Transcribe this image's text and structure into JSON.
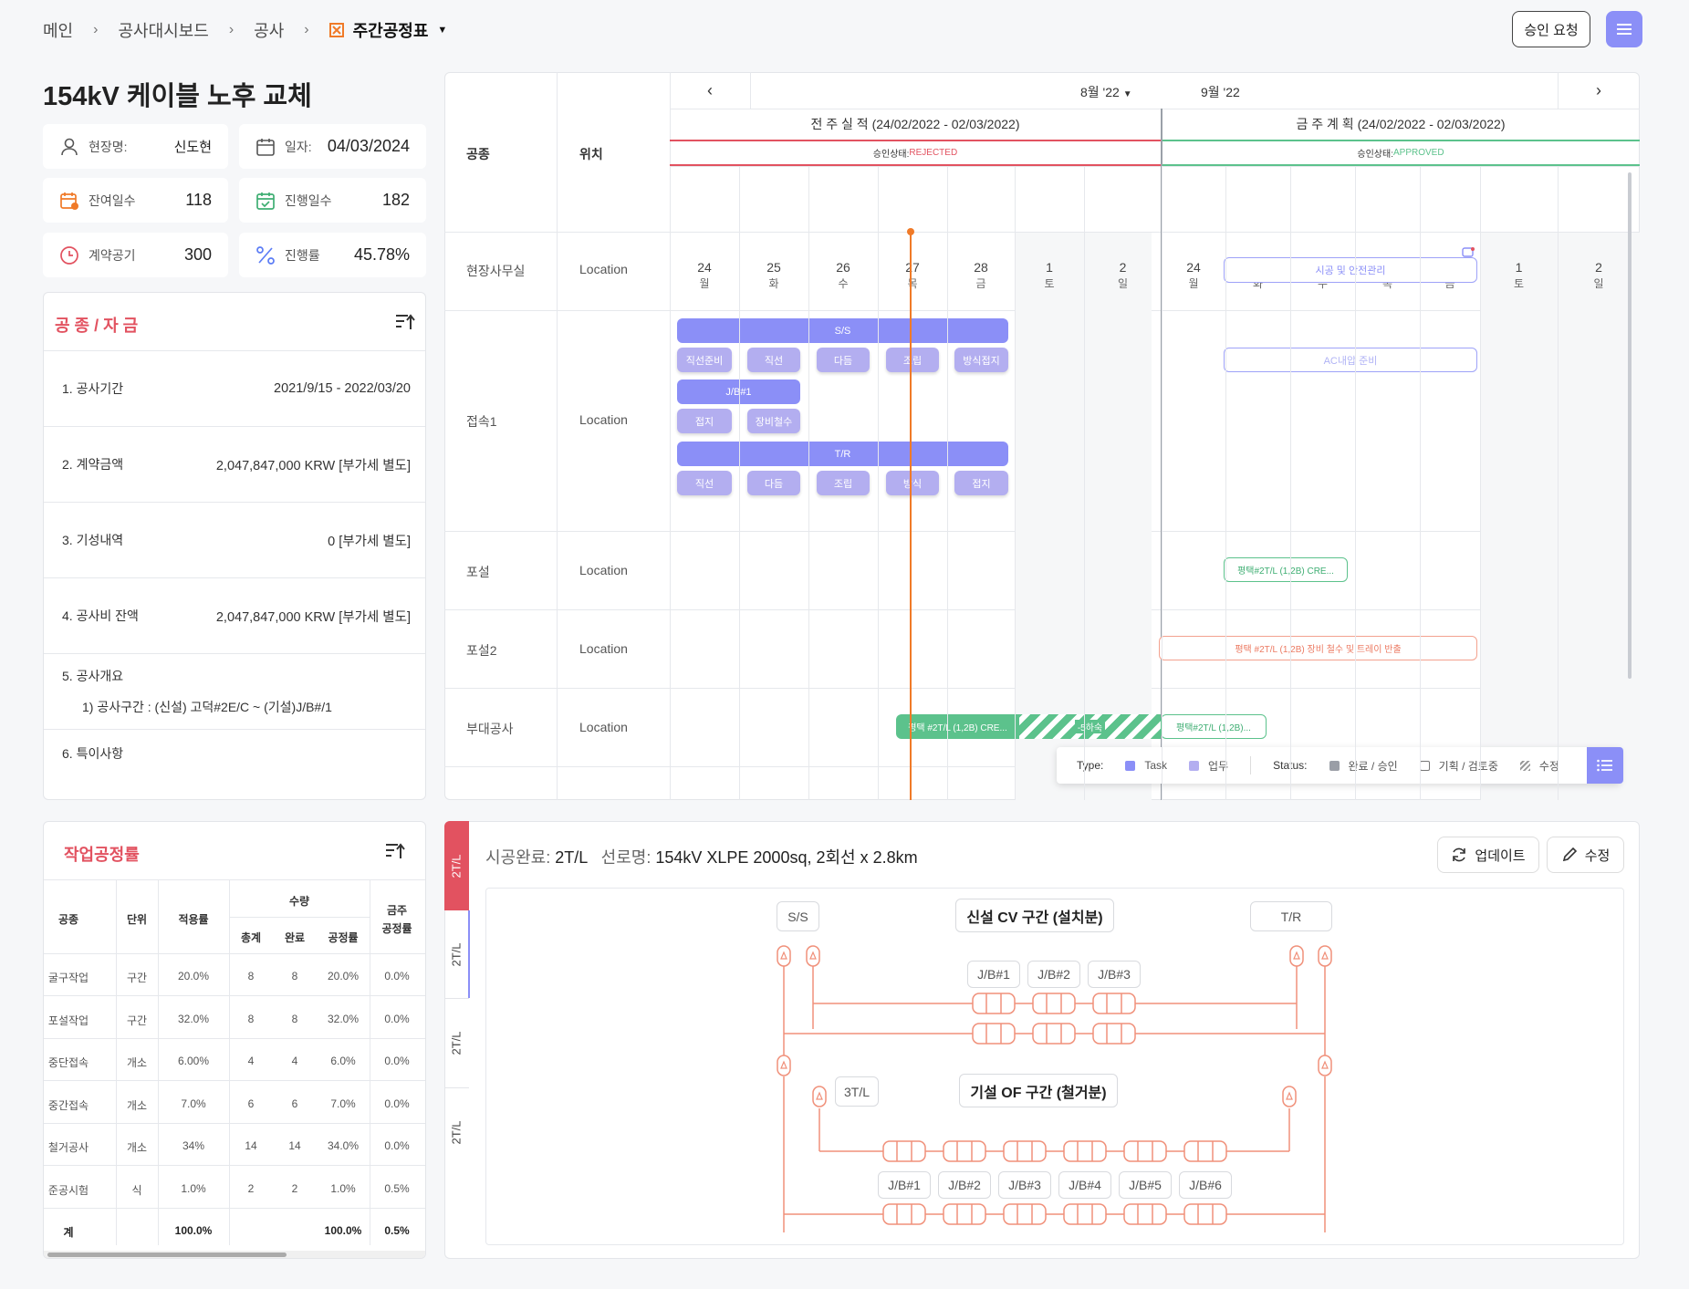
{
  "breadcrumb": {
    "items": [
      "메인",
      "공사대시보드",
      "공사"
    ],
    "current": "주간공정표"
  },
  "header": {
    "approve_label": "승인 요청"
  },
  "project": {
    "title": "154kV 케이블 노후 교체"
  },
  "info": {
    "manager_label": "현장명:",
    "manager_value": "신도현",
    "date_label": "일자:",
    "date_value": "04/03/2024",
    "remaining_label": "잔여일수",
    "remaining_value": "118",
    "progress_days_label": "진행일수",
    "progress_days_value": "182",
    "contract_label": "계약공기",
    "contract_value": "300",
    "rate_label": "진행률",
    "rate_value": "45.78%"
  },
  "funds": {
    "title": "공 종 / 자 금",
    "rows": [
      {
        "label": "1. 공사기간",
        "value": "2021/9/15 - 2022/03/20"
      },
      {
        "label": "2. 계약금액",
        "value": "2,047,847,000 KRW [부가세 별도]"
      },
      {
        "label": "3. 기성내역",
        "value": "0 [부가세 별도]"
      },
      {
        "label": "4. 공사비 잔액",
        "value": "2,047,847,000 KRW [부가세 별도]"
      },
      {
        "label": "5. 공사개요",
        "value": ""
      },
      {
        "label": "6. 특이사항",
        "value": ""
      }
    ],
    "overview": "1) 공사구간 : (신설) 고덕#2E/C ~ (기설)J/B#/1"
  },
  "gantt": {
    "col_work": "공종",
    "col_location": "위치",
    "month1": "8월 '22",
    "month2": "9월 '22",
    "prev_title": "전 주 실 적 (24/02/2022 - 02/03/2022)",
    "next_title": "금 주 계 획 (24/02/2022 - 02/03/2022)",
    "status_label": "승인상태:",
    "prev_status": "REJECTED",
    "next_status": "APPROVED",
    "days": [
      {
        "d": "24",
        "w": "월"
      },
      {
        "d": "25",
        "w": "화"
      },
      {
        "d": "26",
        "w": "수"
      },
      {
        "d": "27",
        "w": "목"
      },
      {
        "d": "28",
        "w": "금"
      },
      {
        "d": "1",
        "w": "토"
      },
      {
        "d": "2",
        "w": "일"
      },
      {
        "d": "24",
        "w": "월"
      },
      {
        "d": "25",
        "w": "화"
      },
      {
        "d": "26",
        "w": "수"
      },
      {
        "d": "27",
        "w": "목"
      },
      {
        "d": "28",
        "w": "금"
      },
      {
        "d": "1",
        "w": "토"
      },
      {
        "d": "2",
        "w": "일"
      }
    ],
    "rows": [
      {
        "name": "현장사무실",
        "loc": "Location"
      },
      {
        "name": "접속1",
        "loc": "Location"
      },
      {
        "name": "포설",
        "loc": "Location"
      },
      {
        "name": "포설2",
        "loc": "Location"
      },
      {
        "name": "부대공사",
        "loc": "Location"
      }
    ],
    "bars": {
      "ss": "S/S",
      "jb": "J/B#1",
      "tr": "T/R",
      "ss_tasks": [
        "직선준비",
        "직선",
        "다듬",
        "조립",
        "방식접지"
      ],
      "jb_tasks": [
        "접지",
        "장비철수"
      ],
      "tr_tasks": [
        "직선",
        "다듬",
        "조립",
        "방식",
        "접지"
      ],
      "safety": "시공 및 안전관리",
      "ac": "AC내압 준비",
      "pole1": "평택#2T/L (1,2B) CRE...",
      "pole2": "평택 #2T/L (1,2B) 장비 철수 및 트레이 반출",
      "sub1": "평택 #2T/L (1,2B) CRE...",
      "sub_delay": "-5하숙",
      "sub2": "평택#2T/L (1,2B)..."
    },
    "legend": {
      "type_label": "Type:",
      "task": "Task",
      "work": "업무",
      "status_label": "Status:",
      "done": "완료 / 승인",
      "plan": "기획 / 검토중",
      "edit": "수정"
    }
  },
  "work": {
    "title": "작업공정률",
    "headers": {
      "type": "공종",
      "unit": "단위",
      "rate": "적용률",
      "qty": "수량",
      "total": "총계",
      "done": "완료",
      "prog": "공정률",
      "week": "금주",
      "week2": "공정률"
    },
    "rows": [
      {
        "type": "굴구작업",
        "unit": "구간",
        "rate": "20.0%",
        "total": "8",
        "done": "8",
        "prog": "20.0%",
        "week": "0.0%"
      },
      {
        "type": "포설작업",
        "unit": "구간",
        "rate": "32.0%",
        "total": "8",
        "done": "8",
        "prog": "32.0%",
        "week": "0.0%"
      },
      {
        "type": "중단접속",
        "unit": "개소",
        "rate": "6.00%",
        "total": "4",
        "done": "4",
        "prog": "6.0%",
        "week": "0.0%"
      },
      {
        "type": "중간접속",
        "unit": "개소",
        "rate": "7.0%",
        "total": "6",
        "done": "6",
        "prog": "7.0%",
        "week": "0.0%"
      },
      {
        "type": "철거공사",
        "unit": "개소",
        "rate": "34%",
        "total": "14",
        "done": "14",
        "prog": "34.0%",
        "week": "0.0%"
      },
      {
        "type": "준공시험",
        "unit": "식",
        "rate": "1.0%",
        "total": "2",
        "done": "2",
        "prog": "1.0%",
        "week": "0.5%"
      }
    ],
    "sum": {
      "type": "계",
      "rate": "100.0%",
      "prog": "100.0%",
      "week": "0.5%"
    }
  },
  "circuit": {
    "done_label": "시공완료:",
    "done_value": "2T/L",
    "line_label": "선로명:",
    "line_value": "154kV XLPE 2000sq, 2회선 x 2.8km",
    "update": "업데이트",
    "edit": "수정",
    "tabs": [
      "2T/L",
      "2T/L",
      "2T/L",
      "2T/L"
    ],
    "ss": "S/S",
    "tr": "T/R",
    "new_section": "신설 CV 구간 (설치분)",
    "old_section": "기설 OF 구간 (철거분)",
    "t3": "3T/L",
    "jb_top": [
      "J/B#1",
      "J/B#2",
      "J/B#3"
    ],
    "jb_bottom": [
      "J/B#1",
      "J/B#2",
      "J/B#3",
      "J/B#4",
      "J/B#5",
      "J/B#6"
    ]
  },
  "colors": {
    "accent": "#8b8ff7",
    "red": "#e25260",
    "green": "#5cc28c",
    "orange": "#f07a28",
    "line": "#f0907a"
  }
}
